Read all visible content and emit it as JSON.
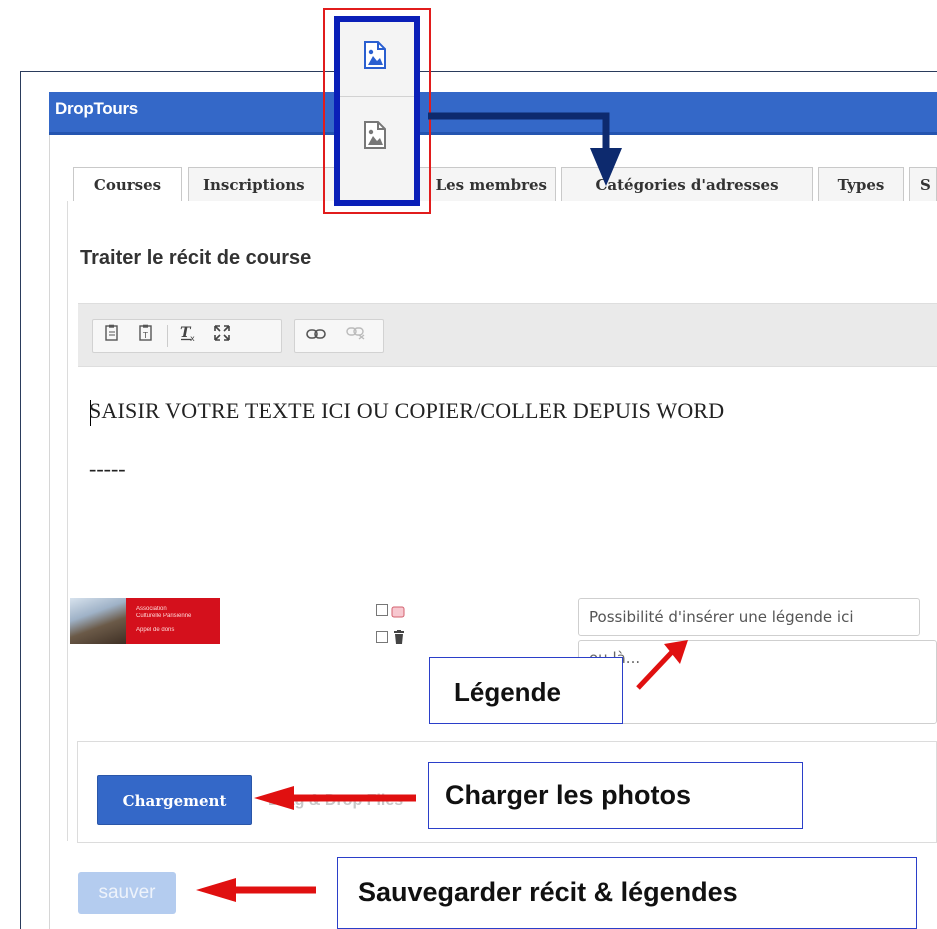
{
  "app": {
    "title": "DropTours"
  },
  "tabs": [
    {
      "label": "Courses"
    },
    {
      "label": "Inscriptions"
    },
    {
      "label": "Les membres"
    },
    {
      "label": "Catégories d'adresses"
    },
    {
      "label": "Types"
    },
    {
      "label": "S"
    }
  ],
  "section": {
    "title": "Traiter le récit de course"
  },
  "toolbar": {
    "icons": [
      "paste-icon",
      "paste-text-icon",
      "remove-format-icon",
      "maximize-icon",
      "link-icon",
      "unlink-icon"
    ]
  },
  "editor": {
    "line1": "SAISIR VOTRE TEXTE ICI OU COPIER/COLLER DEPUIS WORD",
    "line2": "-----"
  },
  "photo": {
    "thumbnail_text": [
      "Association",
      "Culturelle Parisienne",
      "Appel de dons"
    ],
    "caption_value": "Possibilité d'insérer une légende ici",
    "caption_textarea": "ou là..."
  },
  "upload": {
    "button_label": "Chargement",
    "dropzone_text": "Drag & Drop Files"
  },
  "save": {
    "button_label": "sauver"
  },
  "annotations": {
    "legende": "Légende",
    "charger": "Charger les photos",
    "sauvegarder": "Sauvegarder récit & légendes"
  },
  "colors": {
    "header": "#3468c8",
    "annotation_border": "#2b3fc9",
    "arrow_red": "#e01010",
    "arrow_navy": "#0d2a6e",
    "highlight_red": "#e11c1c",
    "highlight_blue": "#0a1fb8"
  }
}
